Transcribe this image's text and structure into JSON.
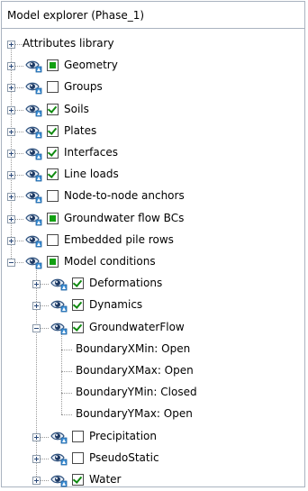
{
  "panel": {
    "title": "Model explorer (Phase_1)"
  },
  "tree": [
    {
      "label": "Attributes library",
      "level": 0,
      "expander": "plus",
      "eye": false,
      "check": null
    },
    {
      "label": "Geometry",
      "level": 0,
      "expander": "plus",
      "eye": true,
      "check": "partial"
    },
    {
      "label": "Groups",
      "level": 0,
      "expander": "plus",
      "eye": true,
      "check": "unchecked"
    },
    {
      "label": "Soils",
      "level": 0,
      "expander": "plus",
      "eye": true,
      "check": "checked"
    },
    {
      "label": "Plates",
      "level": 0,
      "expander": "plus",
      "eye": true,
      "check": "checked"
    },
    {
      "label": "Interfaces",
      "level": 0,
      "expander": "plus",
      "eye": true,
      "check": "checked"
    },
    {
      "label": "Line loads",
      "level": 0,
      "expander": "plus",
      "eye": true,
      "check": "checked"
    },
    {
      "label": "Node-to-node anchors",
      "level": 0,
      "expander": "plus",
      "eye": true,
      "check": "unchecked"
    },
    {
      "label": "Groundwater flow BCs",
      "level": 0,
      "expander": "plus",
      "eye": true,
      "check": "partial"
    },
    {
      "label": "Embedded pile rows",
      "level": 0,
      "expander": "plus",
      "eye": true,
      "check": "unchecked"
    },
    {
      "label": "Model conditions",
      "level": 0,
      "expander": "minus",
      "eye": true,
      "check": "partial"
    },
    {
      "label": "Deformations",
      "level": 1,
      "expander": "plus",
      "eye": true,
      "check": "checked"
    },
    {
      "label": "Dynamics",
      "level": 1,
      "expander": "plus",
      "eye": true,
      "check": "checked"
    },
    {
      "label": "GroundwaterFlow",
      "level": 1,
      "expander": "minus",
      "eye": true,
      "check": "checked"
    },
    {
      "label": "BoundaryXMin: Open",
      "level": 2,
      "expander": null,
      "eye": false,
      "check": null
    },
    {
      "label": "BoundaryXMax: Open",
      "level": 2,
      "expander": null,
      "eye": false,
      "check": null
    },
    {
      "label": "BoundaryYMin: Closed",
      "level": 2,
      "expander": null,
      "eye": false,
      "check": null
    },
    {
      "label": "BoundaryYMax: Open",
      "level": 2,
      "expander": null,
      "eye": false,
      "check": null
    },
    {
      "label": "Precipitation",
      "level": 1,
      "expander": "plus",
      "eye": true,
      "check": "unchecked"
    },
    {
      "label": "PseudoStatic",
      "level": 1,
      "expander": "plus",
      "eye": true,
      "check": "unchecked"
    },
    {
      "label": "Water",
      "level": 1,
      "expander": "plus",
      "eye": true,
      "check": "checked"
    }
  ],
  "colors": {
    "check_green": "#12a012",
    "panel_border": "#aab3c0",
    "tree_line": "#9a9a9a"
  }
}
